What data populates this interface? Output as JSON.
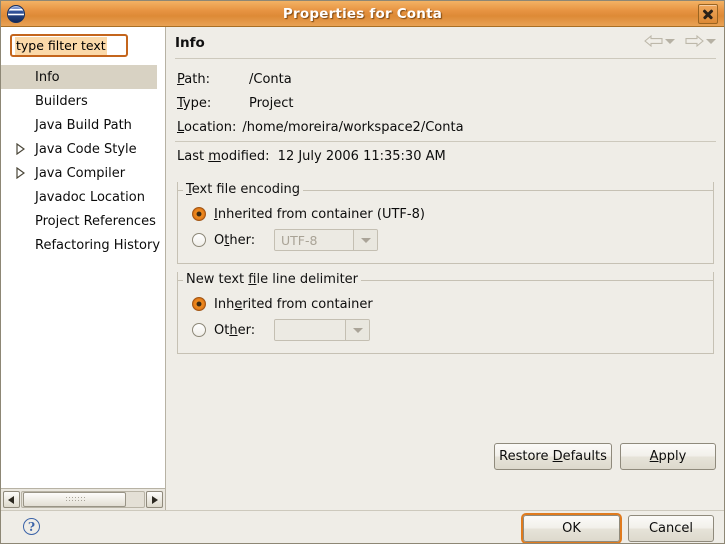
{
  "window": {
    "title": "Properties for Conta",
    "icon": "eclipse-sphere-icon",
    "close_label": "close-icon",
    "accent_color": "#e07b1e",
    "titlebar_color": "#e79442"
  },
  "sidebar": {
    "filter": {
      "value": "type filter text",
      "placeholder": "type filter text",
      "selected": true
    },
    "items": [
      {
        "label": "Info",
        "expandable": false,
        "selected": true
      },
      {
        "label": "Builders",
        "expandable": false,
        "selected": false
      },
      {
        "label": "Java Build Path",
        "expandable": false,
        "selected": false
      },
      {
        "label": "Java Code Style",
        "expandable": true,
        "selected": false
      },
      {
        "label": "Java Compiler",
        "expandable": true,
        "selected": false
      },
      {
        "label": "Javadoc Location",
        "expandable": false,
        "selected": false
      },
      {
        "label": "Project References",
        "expandable": false,
        "selected": false
      },
      {
        "label": "Refactoring History",
        "expandable": false,
        "selected": false
      }
    ],
    "scrollbar": {
      "left_arrow": "scroll-left-icon",
      "right_arrow": "scroll-right-icon"
    }
  },
  "content": {
    "title": "Info",
    "nav": {
      "back": "back-arrow-icon",
      "forward": "forward-arrow-icon"
    },
    "fields": [
      {
        "label_pre": "P",
        "label_mn": "a",
        "label_post": "th:",
        "value": "/Conta"
      },
      {
        "label_pre": "T",
        "label_mn": "y",
        "label_post": "pe:",
        "value": "Project"
      }
    ],
    "path_label": "Path:",
    "path_value": "/Conta",
    "type_label": "Type:",
    "type_value": "Project",
    "location_label": "Location:",
    "location_value": "/home/moreira/workspace2/Conta",
    "last_modified_label": "Last modified:",
    "last_modified_value": "12 July 2006 11:35:30 AM"
  },
  "encoding_group": {
    "title": "Text file encoding",
    "inherited_label": "Inherited from container (UTF-8)",
    "inherited_selected": true,
    "other_label": "Other:",
    "other_selected": false,
    "combo_value": "UTF-8",
    "combo_enabled": false
  },
  "delimiter_group": {
    "title": "New text file line delimiter",
    "inherited_label": "Inherited from container",
    "inherited_selected": true,
    "other_label": "Other:",
    "other_selected": false,
    "combo_value": "",
    "combo_enabled": false
  },
  "buttons": {
    "restore_defaults": "Restore Defaults",
    "apply": "Apply",
    "ok": "OK",
    "cancel": "Cancel",
    "help": "?"
  }
}
